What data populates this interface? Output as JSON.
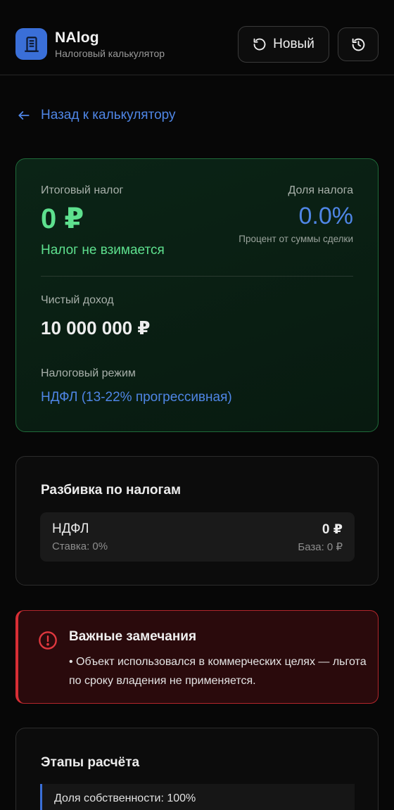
{
  "header": {
    "app_name": "NAlog",
    "app_subtitle": "Налоговый калькулятор",
    "new_button_label": "Новый",
    "accent_color": "#3a6fd8"
  },
  "back_link": {
    "label": "Назад к калькулятору"
  },
  "result": {
    "total_tax_label": "Итоговый налог",
    "total_tax_value": "0 ₽",
    "total_tax_note": "Налог не взимается",
    "tax_share_label": "Доля налога",
    "tax_share_value": "0.0%",
    "tax_share_note": "Процент от суммы сделки",
    "net_income_label": "Чистый доход",
    "net_income_value": "10 000 000 ₽",
    "regime_label": "Налоговый режим",
    "regime_value": "НДФЛ (13-22% прогрессивная)",
    "success_color": "#5ee08e"
  },
  "breakdown": {
    "title": "Разбивка по налогам",
    "items": [
      {
        "name": "НДФЛ",
        "rate": "Ставка: 0%",
        "amount": "0 ₽",
        "base": "База: 0 ₽"
      }
    ]
  },
  "warnings": {
    "title": "Важные замечания",
    "items": [
      "• Объект использовался в коммерческих целях — льгота по сроку владения не применяется."
    ],
    "danger_color": "#d72e35"
  },
  "steps": {
    "title": "Этапы расчёта",
    "items": [
      "Доля собственности: 100%"
    ]
  }
}
